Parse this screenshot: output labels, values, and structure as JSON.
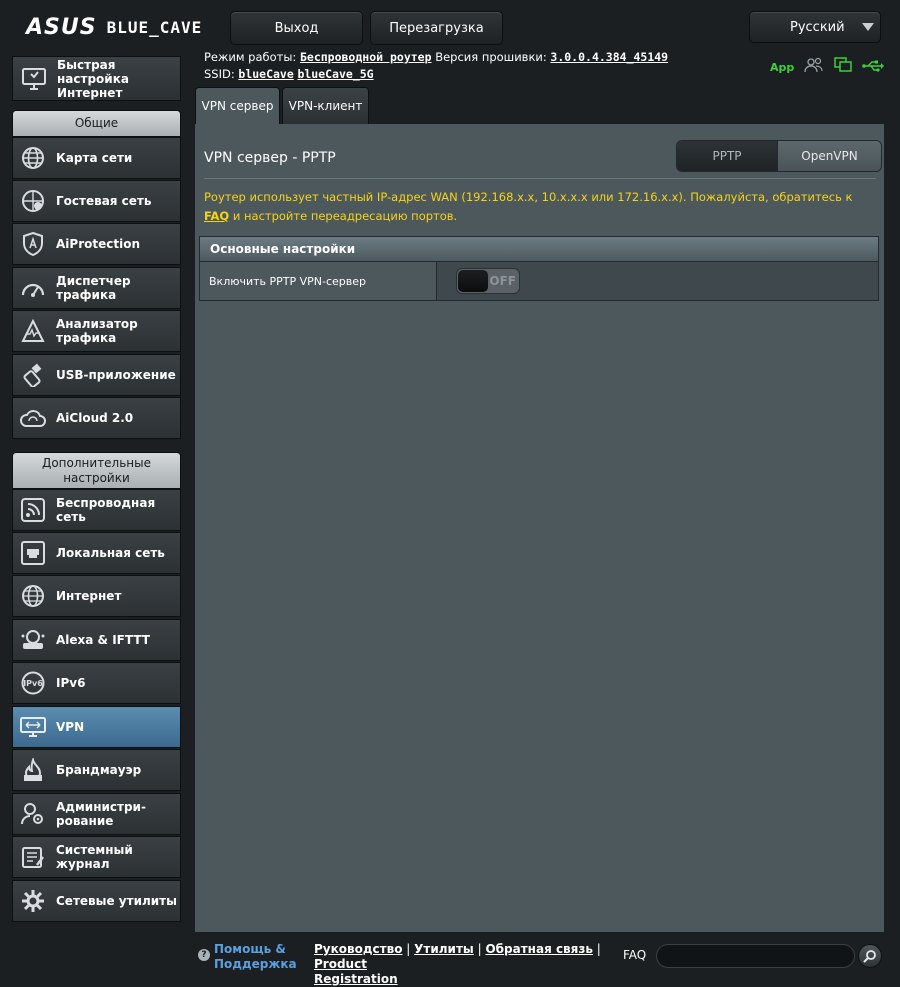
{
  "header": {
    "brand": "ASUS",
    "model": "BLUE_CAVE",
    "logout_label": "Выход",
    "reboot_label": "Перезагрузка",
    "language": "Русский"
  },
  "info": {
    "mode_label": "Режим работы:",
    "mode_value": "Беспроводной роутер",
    "firmware_label": "Версия прошивки:",
    "firmware_value": "3.0.0.4.384_45149",
    "ssid_label": "SSID:",
    "ssid_1": "blueCave",
    "ssid_2": "blueCave_5G",
    "app_label": "App"
  },
  "sidebar": {
    "quick": {
      "line1": "Быстрая настройка",
      "line2": "Интернет"
    },
    "general_header": "Общие",
    "general_items": [
      {
        "label1": "Карта сети",
        "label2": "",
        "icon": "network-map-icon"
      },
      {
        "label1": "Гостевая сеть",
        "label2": "",
        "icon": "guest-network-icon"
      },
      {
        "label1": "AiProtection",
        "label2": "",
        "icon": "aiprotection-icon"
      },
      {
        "label1": "Диспетчер трафика",
        "label2": "",
        "icon": "traffic-manager-icon"
      },
      {
        "label1": "Анализатор",
        "label2": "трафика",
        "icon": "traffic-analyzer-icon"
      },
      {
        "label1": "USB-приложение",
        "label2": "",
        "icon": "usb-app-icon"
      },
      {
        "label1": "AiCloud 2.0",
        "label2": "",
        "icon": "aicloud-icon"
      }
    ],
    "advanced_header_1": "Дополнительные",
    "advanced_header_2": "настройки",
    "advanced_items": [
      {
        "label1": "Беспроводная сеть",
        "label2": "",
        "icon": "wireless-icon"
      },
      {
        "label1": "Локальная сеть",
        "label2": "",
        "icon": "lan-icon"
      },
      {
        "label1": "Интернет",
        "label2": "",
        "icon": "globe-icon"
      },
      {
        "label1": "Alexa & IFTTT",
        "label2": "",
        "icon": "alexa-icon"
      },
      {
        "label1": "IPv6",
        "label2": "",
        "icon": "ipv6-icon"
      },
      {
        "label1": "VPN",
        "label2": "",
        "icon": "vpn-icon"
      },
      {
        "label1": "Брандмауэр",
        "label2": "",
        "icon": "firewall-icon"
      },
      {
        "label1": "Администри-",
        "label2": "рование",
        "icon": "administration-icon"
      },
      {
        "label1": "Системный журнал",
        "label2": "",
        "icon": "system-log-icon"
      },
      {
        "label1": "Сетевые утилиты",
        "label2": "",
        "icon": "network-tools-icon"
      }
    ]
  },
  "tabs": {
    "server": "VPN сервер",
    "client": "VPN-клиент"
  },
  "main": {
    "title": "VPN сервер - PPTP",
    "seg_pptp": "PPTP",
    "seg_openvpn": "OpenVPN",
    "notice_part1": "Роутер использует частный IP-адрес WAN (192.168.x.x, 10.x.x.x или 172.16.x.x). Пожалуйста, обратитесь к ",
    "notice_link": "FAQ",
    "notice_part2": " и настройте переадресацию портов.",
    "section_header": "Основные настройки",
    "row_label": "Включить PPTP VPN-сервер",
    "toggle_state": "OFF"
  },
  "footer": {
    "help_1": "Помощь &",
    "help_2": "Поддержка",
    "link_manual": "Руководство",
    "link_utils": "Утилиты",
    "link_feedback": "Обратная связь",
    "link_product": "Product",
    "link_registration": "Registration",
    "faq_label": "FAQ",
    "search_value": ""
  },
  "colors": {
    "accent_yellow": "#f5d418",
    "active_blue": "#4b7ca1",
    "status_green": "#3bd13b"
  }
}
